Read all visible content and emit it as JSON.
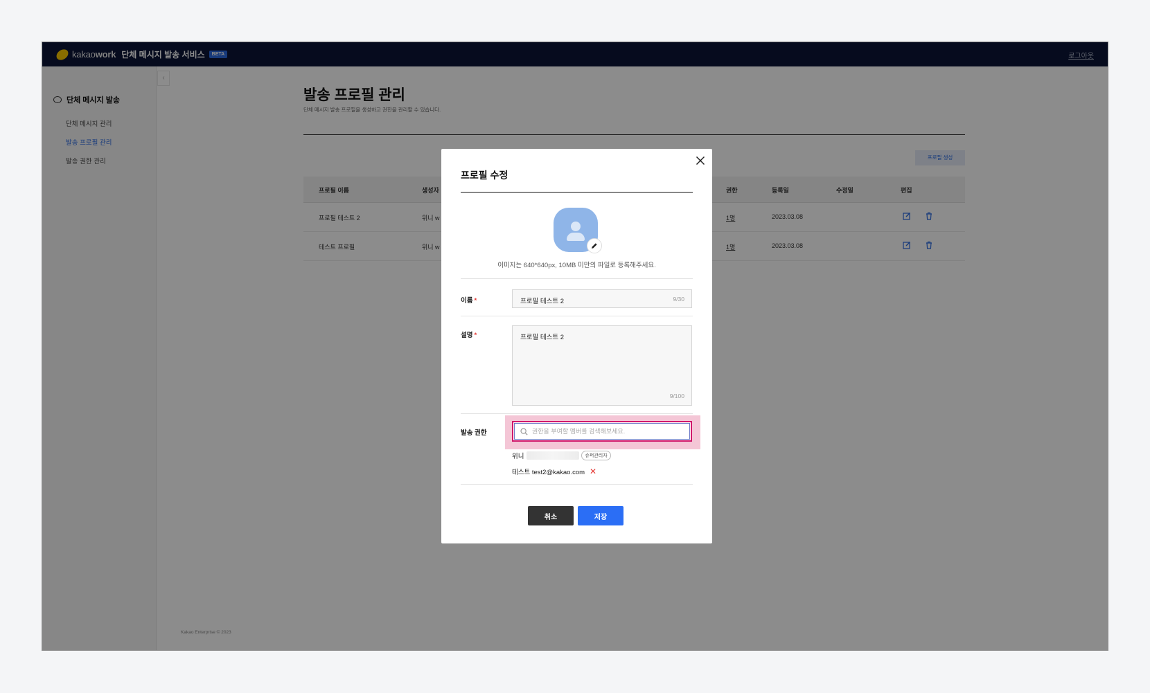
{
  "header": {
    "logo_prefix": "kakao",
    "logo_suffix": "work",
    "service_title": "단체 메시지 발송 서비스",
    "beta_badge": "BETA",
    "logout_label": "로그아웃"
  },
  "sidebar": {
    "section_title": "단체 메시지 발송",
    "items": [
      {
        "label": "단체 메시지 관리",
        "active": false
      },
      {
        "label": "발송 프로필 관리",
        "active": true
      },
      {
        "label": "발송 권한 관리",
        "active": false
      }
    ],
    "collapse_icon": "chevron-left-icon"
  },
  "main": {
    "title": "발송 프로필 관리",
    "description": "단체 메시지 발송 프로필을 생성하고 권한을 관리할 수 있습니다.",
    "create_button": "프로필 생성",
    "table": {
      "columns": [
        "프로필 이름",
        "생성자",
        "권한",
        "등록일",
        "수정일",
        "편집"
      ],
      "rows": [
        {
          "name": "프로필 테스트 2",
          "creator": "위니 w",
          "permission": "1명",
          "registered": "2023.03.08",
          "modified": ""
        },
        {
          "name": "테스트 프로필",
          "creator": "위니 w",
          "permission": "1명",
          "registered": "2023.03.08",
          "modified": ""
        }
      ]
    },
    "footer": "Kakao Enterprise © 2023"
  },
  "modal": {
    "title": "프로필 수정",
    "close_icon": "close-icon",
    "avatar_icon": "user-avatar-icon",
    "edit_icon": "pencil-icon",
    "image_note": "이미지는 640*640px, 10MB 미만의 파일로 등록해주세요.",
    "name": {
      "label": "이름",
      "required_mark": "*",
      "value": "프로필 테스트 2",
      "counter": "9/30"
    },
    "description": {
      "label": "설명",
      "required_mark": "*",
      "value": "프로필 테스트 2",
      "counter": "9/100"
    },
    "permission": {
      "label": "발송 권한",
      "search_placeholder": "권한을 부여할 멤버를 검색해보세요.",
      "members": [
        {
          "name": "위니",
          "badge": "슈퍼관리자"
        },
        {
          "name": "테스트 test2@kakao.com",
          "remove": "✕"
        }
      ]
    },
    "cancel_label": "취소",
    "save_label": "저장"
  },
  "colors": {
    "topbar": "#0c1538",
    "accent": "#2b6ef5",
    "highlight": "#d0186b",
    "required": "#e53935"
  }
}
